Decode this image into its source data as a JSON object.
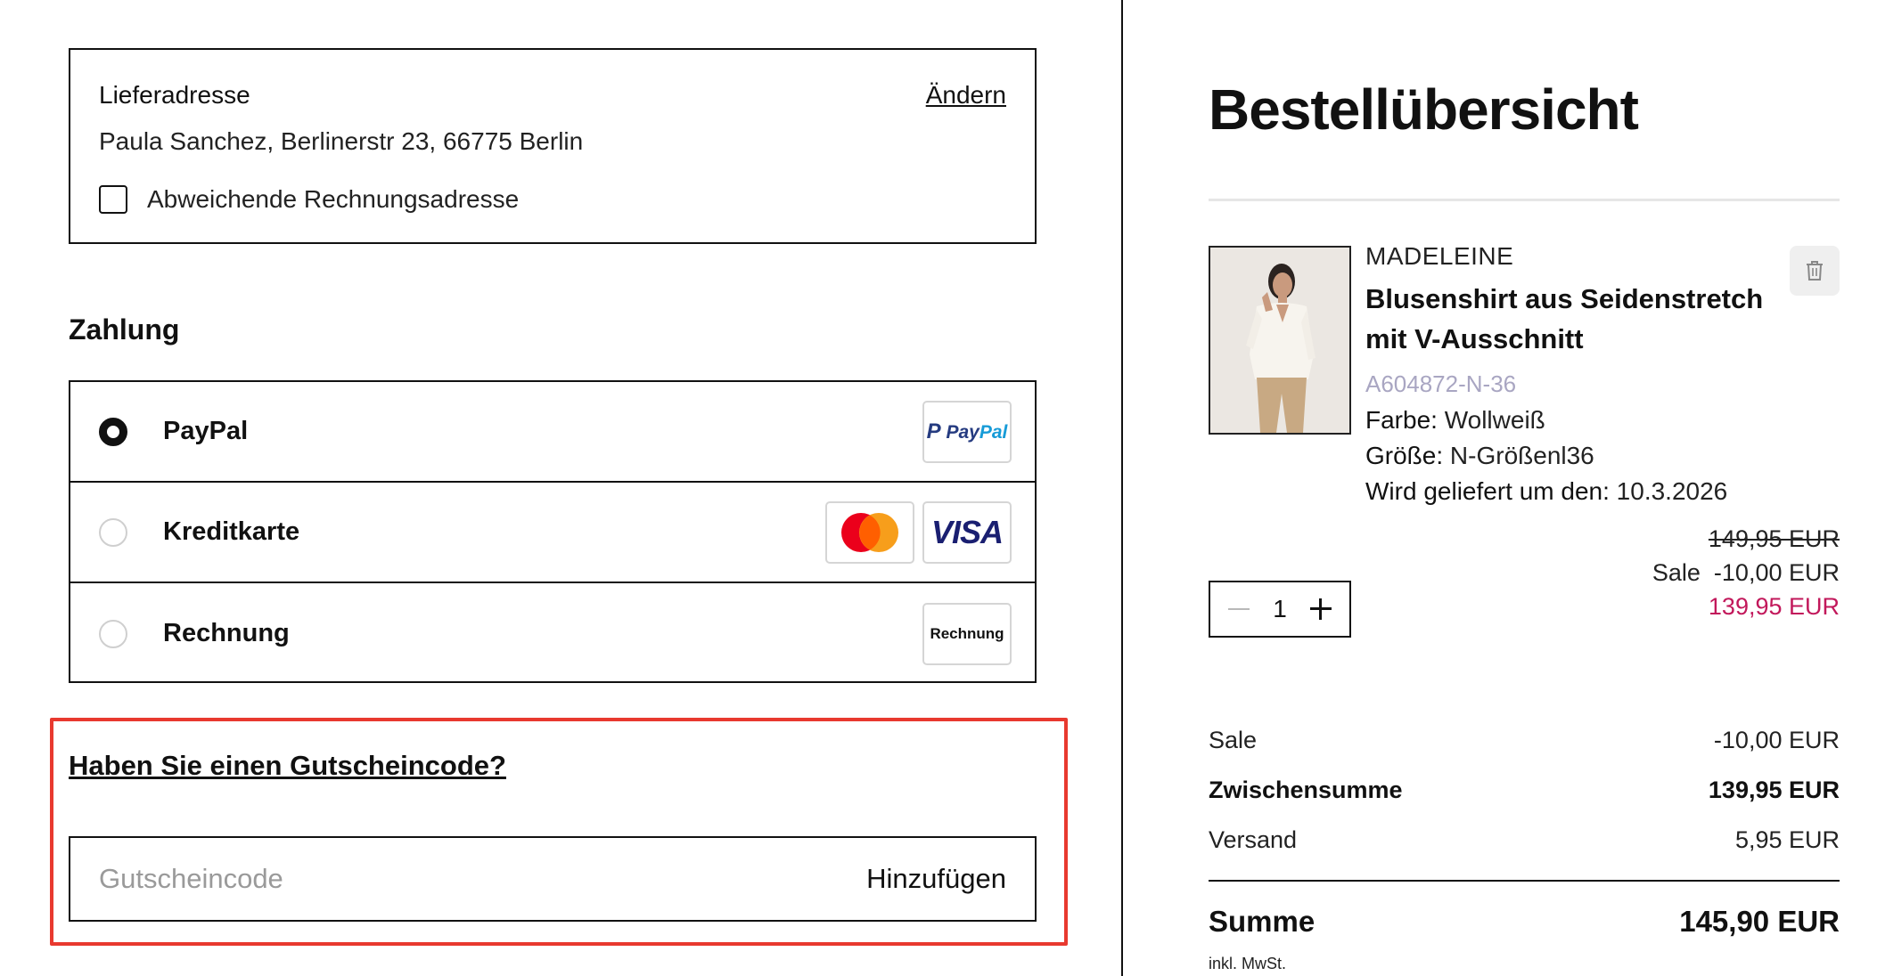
{
  "delivery": {
    "title": "Lieferadresse",
    "change_label": "Ändern",
    "address": "Paula Sanchez, Berlinerstr 23, 66775 Berlin",
    "billing_checkbox_label": "Abweichende Rechnungsadresse"
  },
  "payment": {
    "title": "Zahlung",
    "options": [
      {
        "label": "PayPal",
        "selected": true,
        "logo_text": "PayPal"
      },
      {
        "label": "Kreditkarte",
        "selected": false,
        "logo_text": "VISA"
      },
      {
        "label": "Rechnung",
        "selected": false,
        "logo_text": "Rechnung"
      }
    ]
  },
  "coupon": {
    "title": "Haben Sie einen Gutscheincode?",
    "placeholder": "Gutscheincode",
    "add_label": "Hinzufügen",
    "highlight_color": "#e8392f"
  },
  "summary": {
    "title": "Bestellübersicht",
    "item": {
      "brand": "MADELEINE",
      "name": "Blusenshirt aus Seidenstretch mit V-Ausschnitt",
      "sku": "A604872-N-36",
      "color_label": "Farbe:",
      "color_value": "Wollweiß",
      "size_label": "Größe:",
      "size_value": "N-Größenl36",
      "delivery_label": "Wird geliefert um den:",
      "delivery_value": "10.3.2026",
      "old_price": "149,95 EUR",
      "sale_label": "Sale",
      "sale_amount": "-10,00 EUR",
      "new_price": "139,95 EUR",
      "quantity": "1"
    },
    "totals": {
      "sale_label": "Sale",
      "sale_value": "-10,00 EUR",
      "subtotal_label": "Zwischensumme",
      "subtotal_value": "139,95 EUR",
      "shipping_label": "Versand",
      "shipping_value": "5,95 EUR",
      "sum_label": "Summe",
      "sum_value": "145,90 EUR",
      "vat_note": "inkl. MwSt."
    }
  },
  "colors": {
    "sale_price": "#c2185b",
    "sku": "#a9a6c2",
    "paypal_dark": "#253b80",
    "paypal_light": "#179bd7",
    "visa": "#1a1f71",
    "mastercard_red": "#eb001b",
    "mastercard_orange": "#f79e1b"
  }
}
